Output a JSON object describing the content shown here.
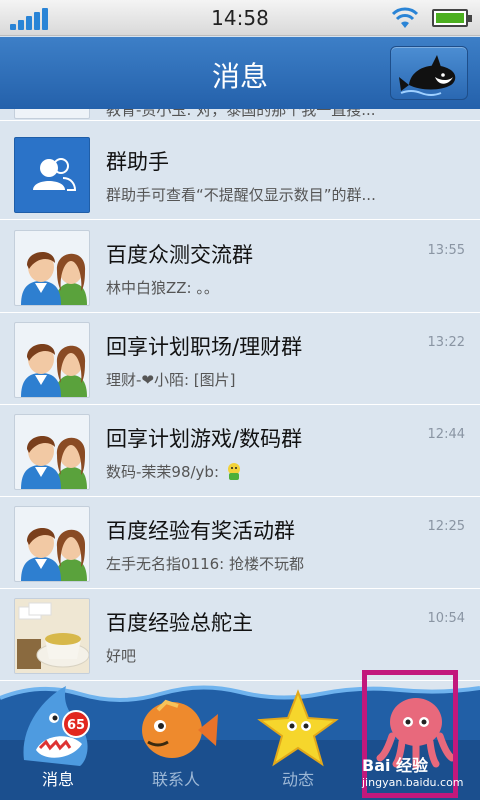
{
  "status": {
    "time": "14:58"
  },
  "header": {
    "title": "消息",
    "whale_button": "whale-icon"
  },
  "conversations": [
    {
      "name": "",
      "preview": "教育-资小玉: 对，泰国的那个我一直搜...",
      "time": "",
      "avatar": "couple"
    },
    {
      "name": "群助手",
      "preview": "群助手可查看“不提醒仅显示数目”的群...",
      "time": "",
      "avatar": "group-helper"
    },
    {
      "name": "百度众测交流群",
      "preview": "林中白狼ZZ: 。。",
      "time": "13:55",
      "avatar": "couple"
    },
    {
      "name": "回享计划职场/理财群",
      "preview": "理财-❤小陌: [图片]",
      "time": "13:22",
      "avatar": "couple"
    },
    {
      "name": "回享计划游戏/数码群",
      "preview": "数码-茉茉98/yb:",
      "time": "12:44",
      "avatar": "couple"
    },
    {
      "name": "百度经验有奖活动群",
      "preview": "左手无名指0116: 抢楼不玩都",
      "time": "12:25",
      "avatar": "couple"
    },
    {
      "name": "百度经验总舵主",
      "preview": "好吧",
      "time": "10:54",
      "avatar": "tea"
    }
  ],
  "tabs": [
    {
      "label": "消息",
      "icon": "shark-icon",
      "badge": "65",
      "active": true
    },
    {
      "label": "联系人",
      "icon": "fish-icon",
      "active": false
    },
    {
      "label": "动态",
      "icon": "starfish-icon",
      "active": false
    },
    {
      "label": "",
      "icon": "octopus-icon",
      "active": false
    }
  ],
  "watermark": {
    "brand": "Bai 经验",
    "url": "jingyan.baidu.com"
  },
  "colors": {
    "header": "#2c6bb6",
    "list_bg": "#dbe5ef",
    "tabbar": "#1d5a9e",
    "badge": "#e1271f",
    "highlight": "#c2187c"
  }
}
